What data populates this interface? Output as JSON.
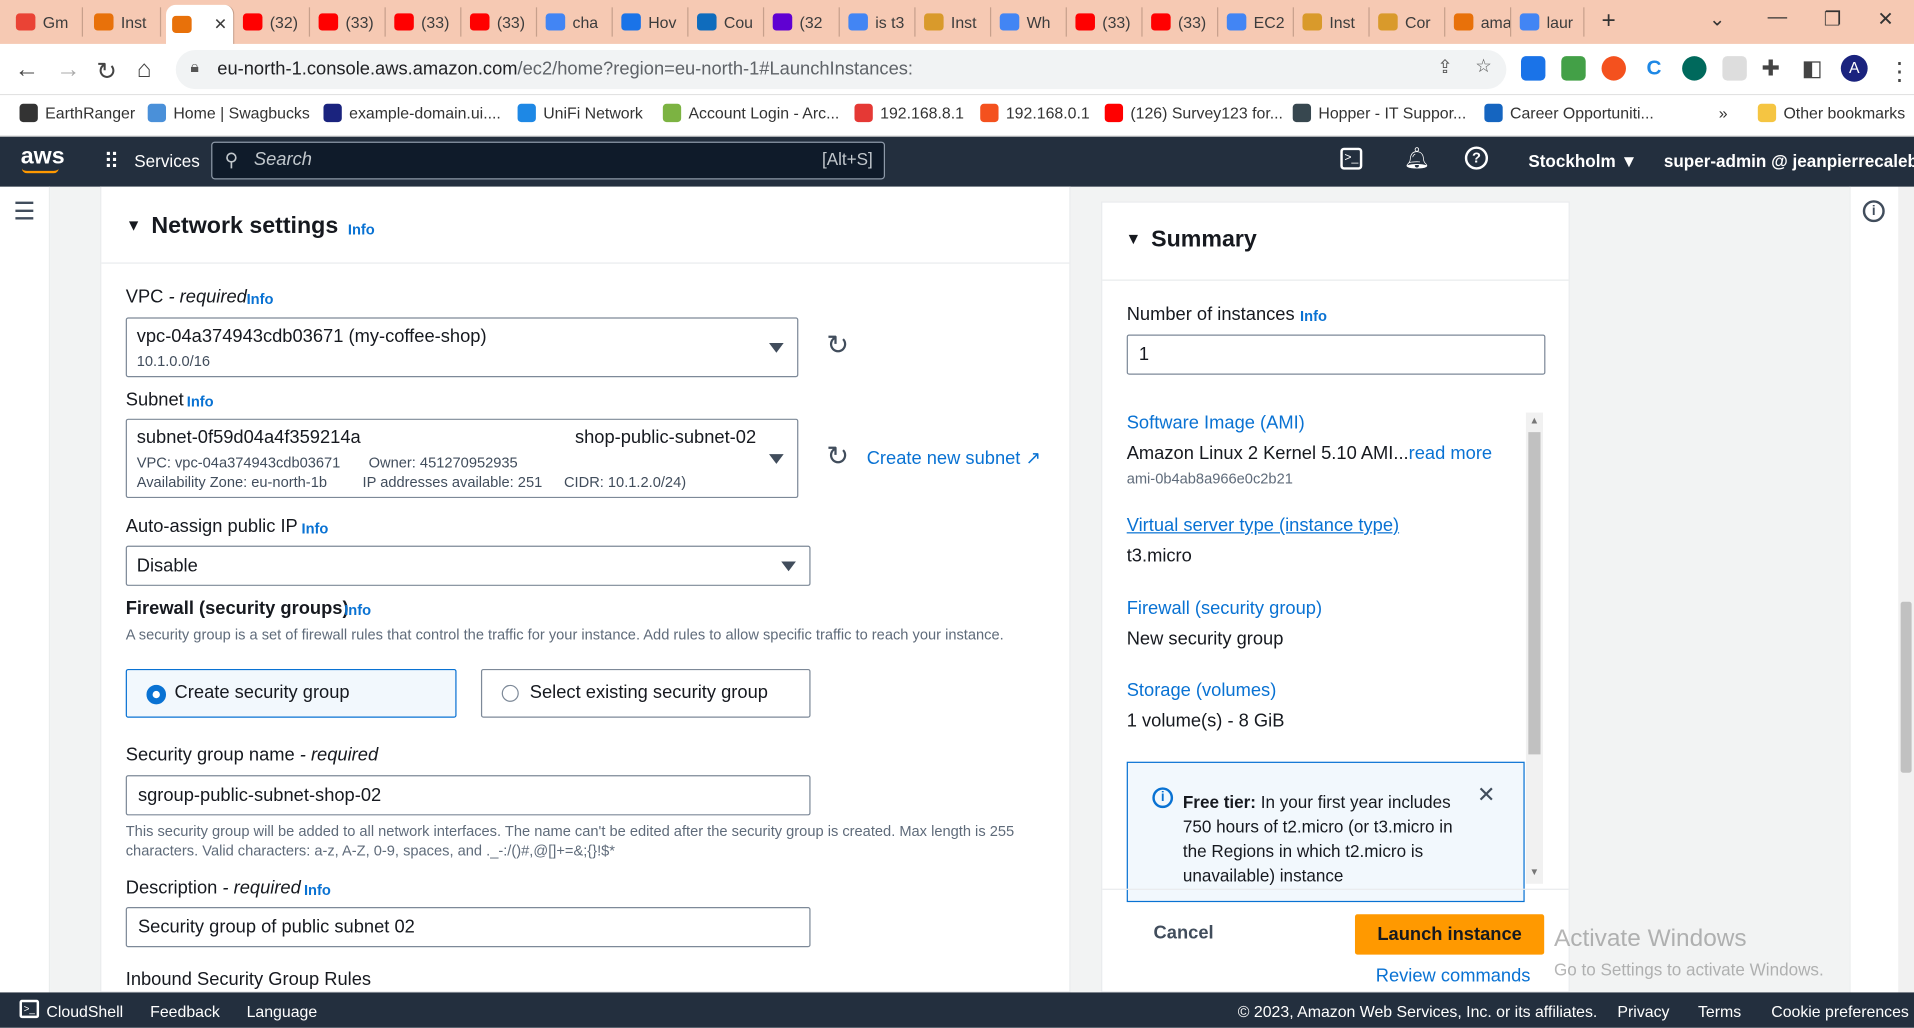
{
  "browser": {
    "tabs": [
      {
        "label": "Gm",
        "icon": "gmail-icon",
        "color": "#ea4335"
      },
      {
        "label": "Inst",
        "icon": "aws-icon",
        "color": "#e8710a"
      },
      {
        "label": "",
        "icon": "aws-icon",
        "color": "#e8710a"
      },
      {
        "label": "(32)",
        "icon": "youtube-icon",
        "color": "#ff0000"
      },
      {
        "label": "(33)",
        "icon": "youtube-icon",
        "color": "#ff0000"
      },
      {
        "label": "(33)",
        "icon": "youtube-icon",
        "color": "#ff0000"
      },
      {
        "label": "(33)",
        "icon": "youtube-icon",
        "color": "#ff0000"
      },
      {
        "label": "cha",
        "icon": "google-icon",
        "color": "#4285f4"
      },
      {
        "label": "Hov",
        "icon": "asterisk-icon",
        "color": "#1a73e8"
      },
      {
        "label": "Cou",
        "icon": "outlook-icon",
        "color": "#0f6cbd"
      },
      {
        "label": "(32",
        "icon": "yahoo-mail-icon",
        "color": "#6001d2"
      },
      {
        "label": "is t3",
        "icon": "google-icon",
        "color": "#4285f4"
      },
      {
        "label": "Inst",
        "icon": "aws-doc-icon",
        "color": "#d99a2b"
      },
      {
        "label": "Wh",
        "icon": "google-icon",
        "color": "#4285f4"
      },
      {
        "label": "(33)",
        "icon": "youtube-icon",
        "color": "#ff0000"
      },
      {
        "label": "(33)",
        "icon": "youtube-icon",
        "color": "#ff0000"
      },
      {
        "label": "EC2",
        "icon": "google-icon",
        "color": "#4285f4"
      },
      {
        "label": "Inst",
        "icon": "aws-doc-icon",
        "color": "#d99a2b"
      },
      {
        "label": "Cor",
        "icon": "aws-doc-icon",
        "color": "#d99a2b"
      },
      {
        "label": "ama",
        "icon": "amazon-icon",
        "color": "#e8710a"
      },
      {
        "label": "laur",
        "icon": "google-icon",
        "color": "#4285f4"
      }
    ],
    "url_prefix": "eu-north-1.console.aws.amazon.com",
    "url_rest": "/ec2/home?region=eu-north-1#LaunchInstances:",
    "bookmarks": [
      {
        "label": "EarthRanger",
        "color": "#333333"
      },
      {
        "label": "Home | Swagbucks",
        "color": "#4a90d9"
      },
      {
        "label": "example-domain.ui....",
        "color": "#1a237e"
      },
      {
        "label": "UniFi Network",
        "color": "#1e88e5"
      },
      {
        "label": "Account Login - Arc...",
        "color": "#7cb342"
      },
      {
        "label": "192.168.8.1",
        "color": "#e53935"
      },
      {
        "label": "192.168.0.1",
        "color": "#f4511e"
      },
      {
        "label": "(126) Survey123 for...",
        "color": "#ff0000"
      },
      {
        "label": "Hopper - IT Suppor...",
        "color": "#37474f"
      },
      {
        "label": "Career Opportuniti...",
        "color": "#1565c0"
      }
    ],
    "other_bookmarks": "Other bookmarks"
  },
  "aws_header": {
    "logo": "aws",
    "services": "Services",
    "search_placeholder": "Search",
    "search_shortcut": "[Alt+S]",
    "region": "Stockholm",
    "account": "super-admin @ jeanpierrecaleb"
  },
  "network": {
    "title": "Network settings",
    "info": "Info",
    "vpc_label": "VPC",
    "vpc_required": "- required",
    "vpc_value": "vpc-04a374943cdb03671 (my-coffee-shop)",
    "vpc_cidr": "10.1.0.0/16",
    "subnet_label": "Subnet",
    "subnet_id": "subnet-0f59d04a4f359214a",
    "subnet_name": "shop-public-subnet-02",
    "subnet_vpc": "VPC: vpc-04a374943cdb03671",
    "subnet_owner": "Owner: 451270952935",
    "subnet_az": "Availability Zone: eu-north-1b",
    "subnet_ips": "IP addresses available: 251",
    "subnet_cidr": "CIDR: 10.1.2.0/24)",
    "create_subnet": "Create new subnet",
    "autoip_label": "Auto-assign public IP",
    "autoip_value": "Disable",
    "firewall_label": "Firewall (security groups)",
    "firewall_desc": "A security group is a set of firewall rules that control the traffic for your instance. Add rules to allow specific traffic to reach your instance.",
    "opt_create": "Create security group",
    "opt_existing": "Select existing security group",
    "sg_name_label": "Security group name",
    "sg_name_required": "- required",
    "sg_name_value": "sgroup-public-subnet-shop-02",
    "sg_name_help": "This security group will be added to all network interfaces. The name can't be edited after the security group is created. Max length is 255 characters. Valid characters: a-z, A-Z, 0-9, spaces, and ._-:/()#,@[]+=&;{}!$*",
    "desc_label": "Description",
    "desc_required": "- required",
    "desc_value": "Security group of public subnet 02",
    "inbound_label": "Inbound Security Group Rules"
  },
  "summary": {
    "title": "Summary",
    "num_label": "Number of instances",
    "info": "Info",
    "num_value": "1",
    "ami_label": "Software Image (AMI)",
    "ami_value": "Amazon Linux 2 Kernel 5.10 AMI...",
    "read_more": "read more",
    "ami_id": "ami-0b4ab8a966e0c2b21",
    "type_label": "Virtual server type (instance type)",
    "type_value": "t3.micro",
    "fw_label": "Firewall (security group)",
    "fw_value": "New security group",
    "storage_label": "Storage (volumes)",
    "storage_value": "1 volume(s) - 8 GiB",
    "free_tier_bold": "Free tier:",
    "free_tier_text": "In your first year includes 750 hours of t2.micro (or t3.micro in the Regions in which t2.micro is unavailable) instance",
    "cancel": "Cancel",
    "launch": "Launch instance",
    "review": "Review commands"
  },
  "watermark": {
    "line1": "Activate Windows",
    "line2": "Go to Settings to activate Windows."
  },
  "footer": {
    "cloudshell": "CloudShell",
    "feedback": "Feedback",
    "language": "Language",
    "copyright": "© 2023, Amazon Web Services, Inc. or its affiliates.",
    "privacy": "Privacy",
    "terms": "Terms",
    "cookies": "Cookie preferences"
  }
}
